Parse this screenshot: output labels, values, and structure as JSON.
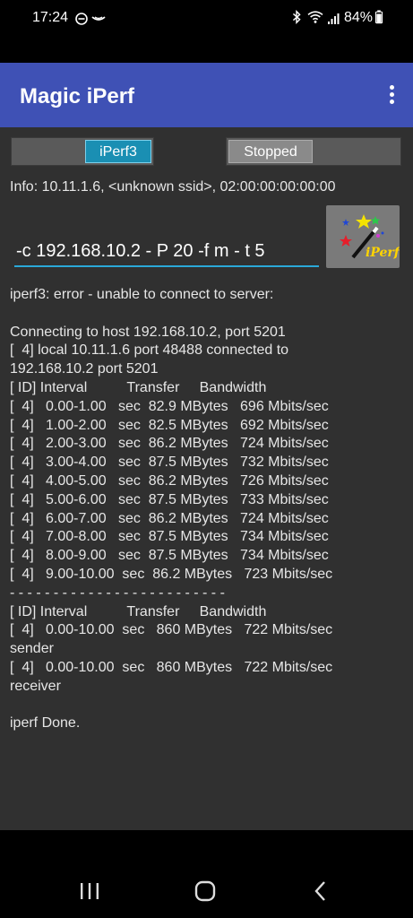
{
  "status": {
    "time": "17:24",
    "battery": "84%"
  },
  "app": {
    "title": "Magic iPerf"
  },
  "mode": {
    "left_option": "iPerf3",
    "right_option": "Stopped"
  },
  "info": "Info: 10.11.1.6, <unknown ssid>, 02:00:00:00:00:00",
  "command": {
    "value": "-c 192.168.10.2 - P 20 -f m - t 5"
  },
  "logo": {
    "text": "iPerf"
  },
  "output_lines": [
    "iperf3: error - unable to connect to server:",
    "",
    "Connecting to host 192.168.10.2, port 5201",
    "[  4] local 10.11.1.6 port 48488 connected to",
    "192.168.10.2 port 5201",
    "[ ID] Interval          Transfer     Bandwidth",
    "[  4]   0.00-1.00   sec  82.9 MBytes   696 Mbits/sec",
    "[  4]   1.00-2.00   sec  82.5 MBytes   692 Mbits/sec",
    "[  4]   2.00-3.00   sec  86.2 MBytes   724 Mbits/sec",
    "[  4]   3.00-4.00   sec  87.5 MBytes   732 Mbits/sec",
    "[  4]   4.00-5.00   sec  86.2 MBytes   726 Mbits/sec",
    "[  4]   5.00-6.00   sec  87.5 MBytes   733 Mbits/sec",
    "[  4]   6.00-7.00   sec  86.2 MBytes   724 Mbits/sec",
    "[  4]   7.00-8.00   sec  87.5 MBytes   734 Mbits/sec",
    "[  4]   8.00-9.00   sec  87.5 MBytes   734 Mbits/sec",
    "[  4]   9.00-10.00  sec  86.2 MBytes   723 Mbits/sec",
    "- - - - - - - - - - - - - - - - - - - - - - - - -",
    "[ ID] Interval          Transfer     Bandwidth",
    "[  4]   0.00-10.00  sec   860 MBytes   722 Mbits/sec",
    "sender",
    "[  4]   0.00-10.00  sec   860 MBytes   722 Mbits/sec",
    "receiver",
    "",
    "iperf Done."
  ],
  "colors": {
    "app_bar": "#3f51b5",
    "accent": "#2aa8d8",
    "background": "#303030"
  },
  "icons": {
    "status_left": [
      "do-not-disturb-icon",
      "signal-wave-icon"
    ],
    "status_right": [
      "bluetooth-icon",
      "wifi-icon",
      "cell-signal-icon",
      "battery-icon"
    ],
    "menu": "more-vert-icon",
    "nav": [
      "recents-icon",
      "home-icon",
      "back-icon"
    ]
  }
}
